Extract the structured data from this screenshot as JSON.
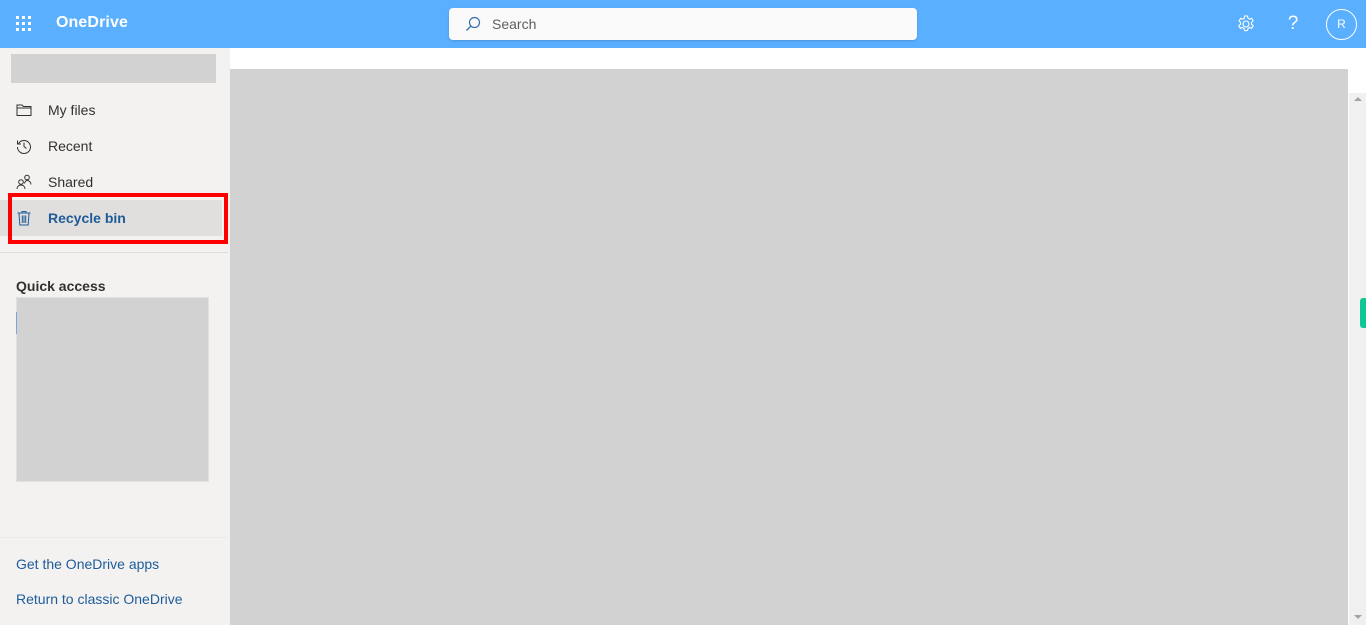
{
  "app": {
    "title": "OneDrive",
    "brand_color": "#5aaffe",
    "accent_color": "#1e5c99",
    "highlight_color": "#ff0000"
  },
  "topbar": {
    "waffle_icon": "app-launcher-icon",
    "search": {
      "placeholder": "Search",
      "value": ""
    },
    "settings_icon": "gear-icon",
    "help_label": "?",
    "avatar_initial": "R"
  },
  "sidebar": {
    "items": [
      {
        "label": "My files",
        "icon": "folder-icon",
        "active": false
      },
      {
        "label": "Recent",
        "icon": "history-icon",
        "active": false
      },
      {
        "label": "Shared",
        "icon": "people-icon",
        "active": false
      },
      {
        "label": "Recycle bin",
        "icon": "trash-icon",
        "active": true
      }
    ],
    "quick_access_title": "Quick access",
    "links": [
      {
        "label": "Get the OneDrive apps"
      },
      {
        "label": "Return to classic OneDrive"
      }
    ]
  }
}
